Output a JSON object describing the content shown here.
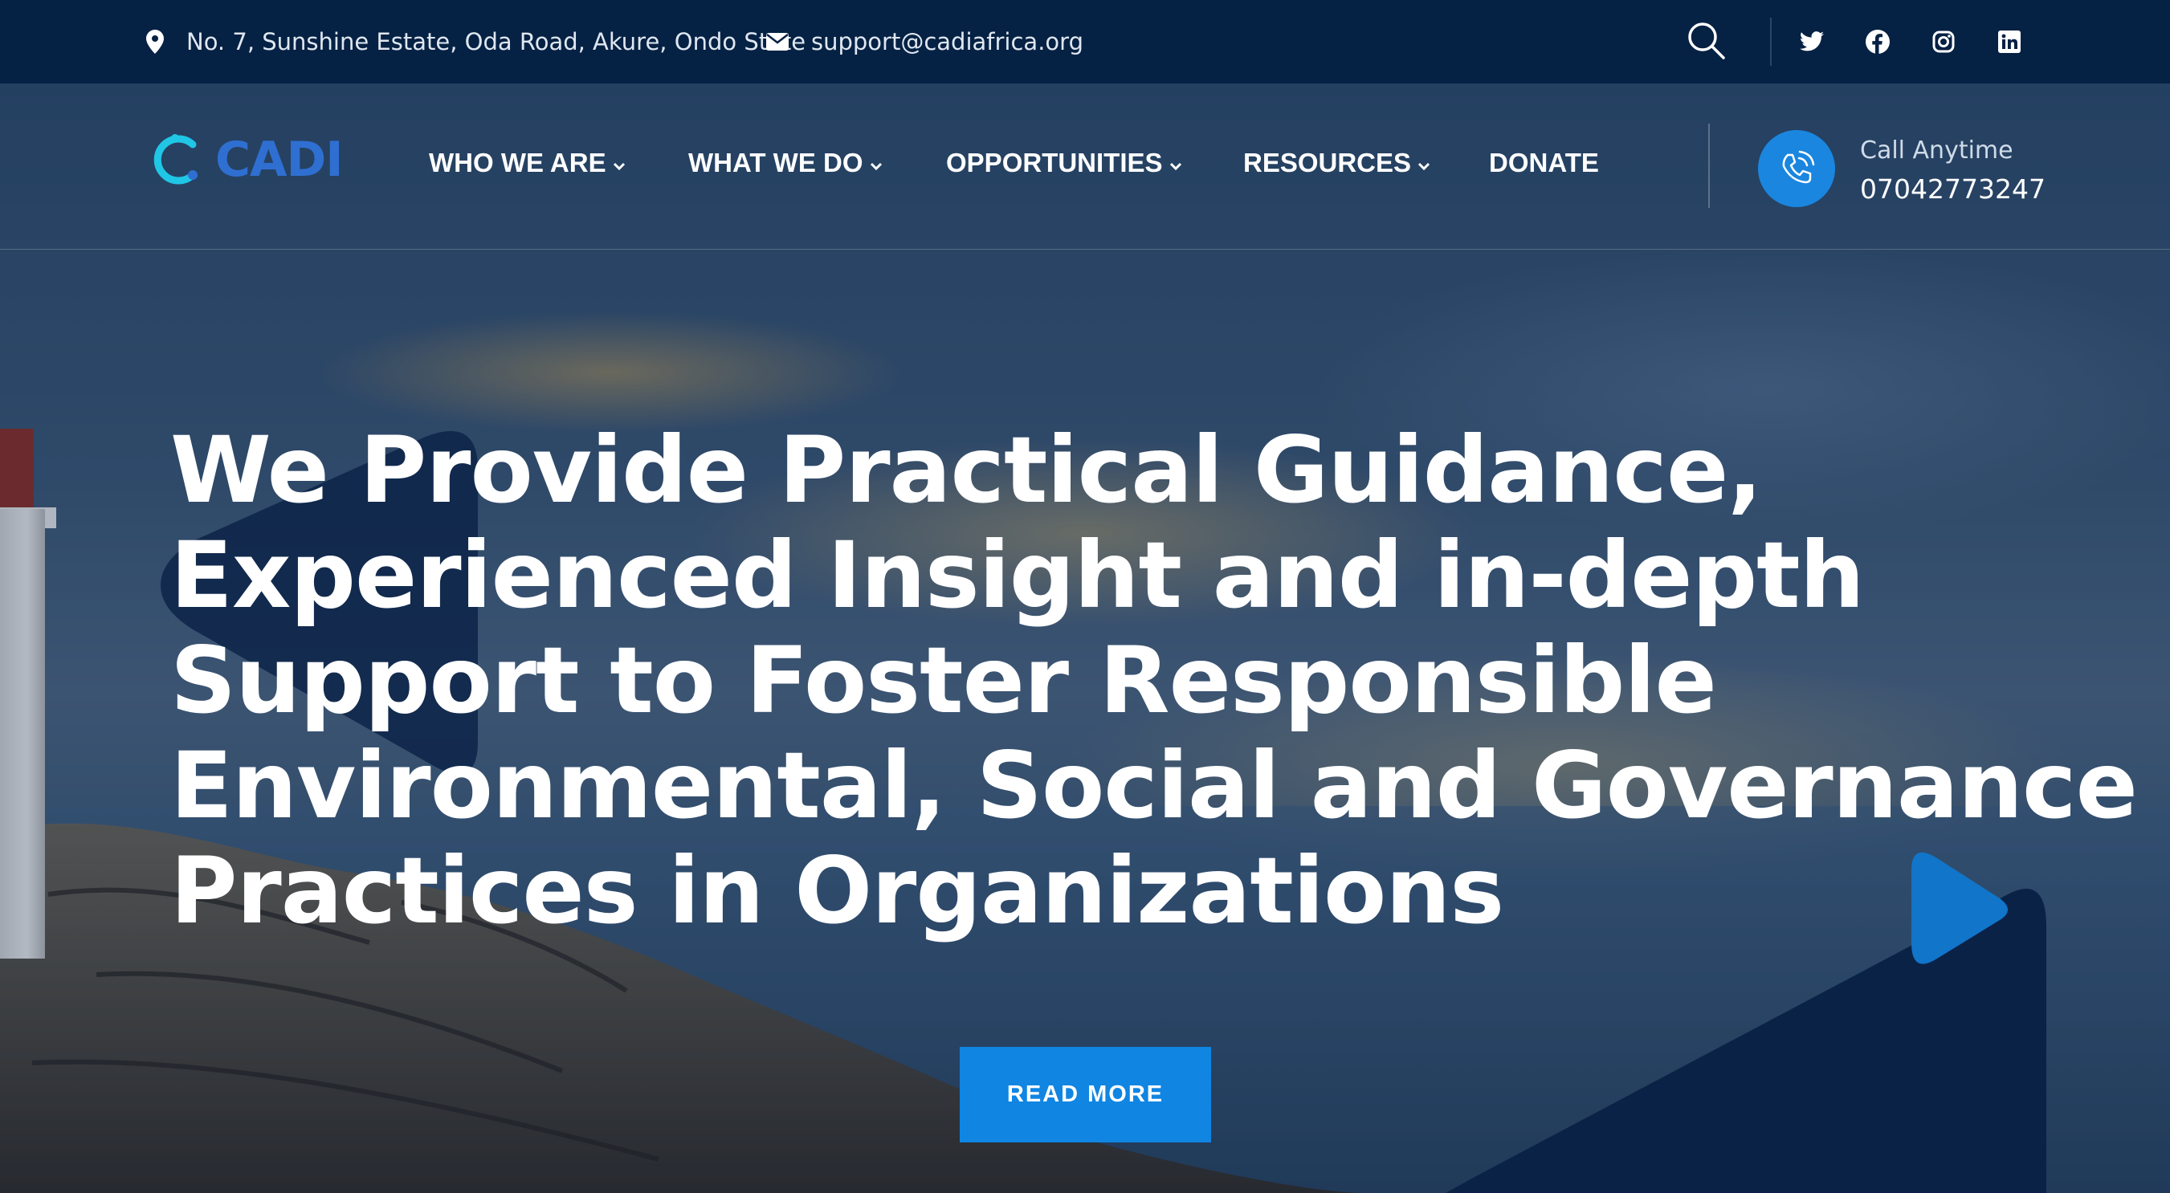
{
  "topbar": {
    "address": "No. 7, Sunshine Estate, Oda Road, Akure, Ondo State",
    "email": "support@cadiafrica.org",
    "icons": [
      "map-pin-icon",
      "envelope-icon",
      "search-icon",
      "twitter-icon",
      "facebook-icon",
      "instagram-icon",
      "linkedin-icon"
    ]
  },
  "nav": {
    "logo_text": "CADI",
    "items": [
      {
        "label": "WHO WE ARE",
        "has_dropdown": true
      },
      {
        "label": "WHAT WE DO",
        "has_dropdown": true
      },
      {
        "label": "OPPORTUNITIES",
        "has_dropdown": true
      },
      {
        "label": "RESOURCES",
        "has_dropdown": true
      },
      {
        "label": "DONATE",
        "has_dropdown": false
      }
    ],
    "call_label": "Call Anytime",
    "call_number": "07042773247"
  },
  "hero": {
    "headline_lines": [
      "We Provide Practical Guidance,",
      "Experienced Insight and in-depth",
      "Support to Foster Responsible",
      "Environmental, Social and Governance",
      "Practices in Organizations"
    ],
    "button_label": "READ MORE"
  },
  "colors": {
    "topbar_bg": "#052143",
    "accent_blue": "#1085e2",
    "logo_blue": "#2f6fd1",
    "logo_cyan": "#20c6e6",
    "dark_shape": "#0b2247"
  }
}
